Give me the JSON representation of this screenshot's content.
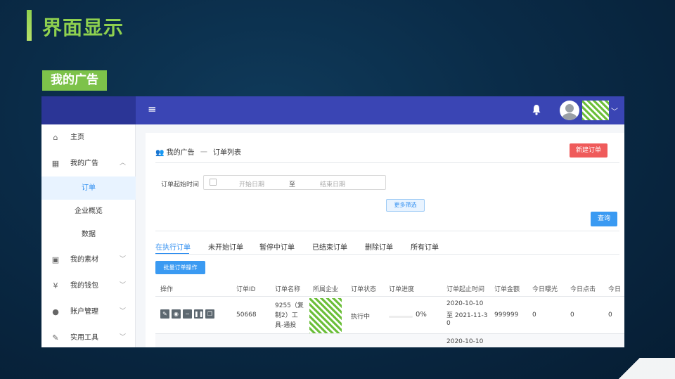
{
  "slide": {
    "title": "界面显示",
    "section": "我的广告"
  },
  "colors": {
    "accent_green": "#8fd14f",
    "topbar": "#3a45b4",
    "primary": "#3a9af2",
    "danger": "#ef5b5b"
  },
  "topbar": {
    "menu_icon": "hamburger-icon",
    "bell_icon": "bell-icon"
  },
  "sidebar": {
    "items": [
      {
        "icon": "home-icon",
        "glyph": "⌂",
        "label": "主页",
        "arrow": ""
      },
      {
        "icon": "grid-icon",
        "glyph": "▦",
        "label": "我的广告",
        "arrow": "︿"
      },
      {
        "icon": "image-icon",
        "glyph": "▣",
        "label": "我的素材",
        "arrow": "﹀"
      },
      {
        "icon": "yen-icon",
        "glyph": "¥",
        "label": "我的钱包",
        "arrow": "﹀"
      },
      {
        "icon": "user-icon",
        "glyph": "●",
        "label": "账户管理",
        "arrow": "﹀"
      },
      {
        "icon": "wrench-icon",
        "glyph": "✎",
        "label": "实用工具",
        "arrow": "﹀"
      }
    ],
    "subitems": [
      {
        "label": "订单"
      },
      {
        "label": "企业概览"
      },
      {
        "label": "数据"
      }
    ]
  },
  "main": {
    "breadcrumb": {
      "parent": "我的广告",
      "sep": "一",
      "current": "订单列表"
    },
    "new_order": "新建订单",
    "filter": {
      "label": "订单起始时间",
      "start_placeholder": "开始日期",
      "to": "至",
      "end_placeholder": "结束日期"
    },
    "more_filters": "更多筛选",
    "query": "查询",
    "tabs": [
      "在执行订单",
      "未开始订单",
      "暂停中订单",
      "已结束订单",
      "删除订单",
      "所有订单"
    ],
    "batch": "批量订单操作",
    "columns": [
      "操作",
      "订单ID",
      "订单名称",
      "所属企业",
      "订单状态",
      "订单进度",
      "订单起止时间",
      "订单金额",
      "今日曝光",
      "今日点击",
      "今日"
    ],
    "rows": [
      {
        "id": "50668",
        "name_lines": [
          "9255（复",
          "制2）工",
          "具-通投"
        ],
        "status": "执行中",
        "progress": "0%",
        "progress_value": 0,
        "date_lines": [
          "2020-10-10",
          "至 2021-11-3",
          "0"
        ],
        "amount": "999999",
        "impressions": "0",
        "clicks": "0",
        "today": "0"
      },
      {
        "date_lines": [
          "2020-10-10"
        ]
      }
    ]
  }
}
